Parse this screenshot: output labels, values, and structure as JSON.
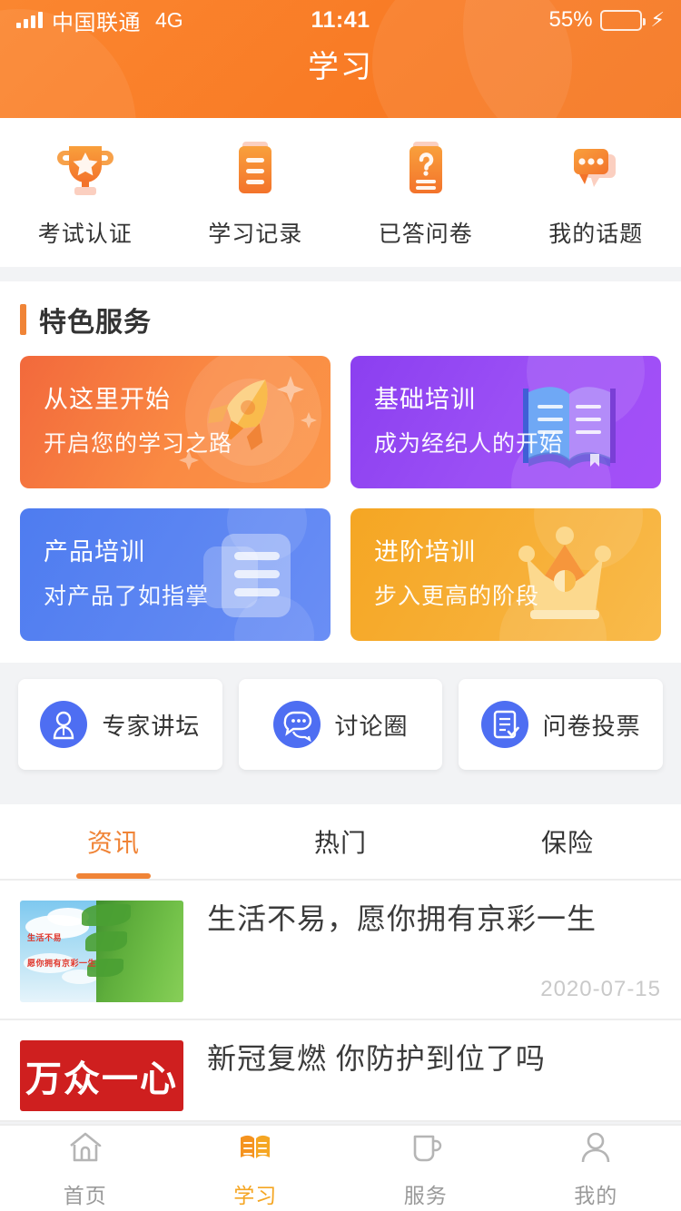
{
  "statusbar": {
    "carrier": "中国联通",
    "network": "4G",
    "time": "11:41",
    "battery_pct": "55%",
    "battery_level": 55,
    "charging_icon": "⚡"
  },
  "header": {
    "title": "学习",
    "bg_color": "#f97b25"
  },
  "quick_actions": [
    {
      "label": "考试认证",
      "icon": "trophy-icon"
    },
    {
      "label": "学习记录",
      "icon": "document-lines-icon"
    },
    {
      "label": "已答问卷",
      "icon": "document-question-icon"
    },
    {
      "label": "我的话题",
      "icon": "chat-bubble-icon"
    }
  ],
  "featured": {
    "section_title": "特色服务",
    "accent_color": "#f08437",
    "cards": [
      {
        "title": "从这里开始",
        "subtitle": "开启您的学习之路",
        "theme": "c-orange",
        "art": "rocket-icon",
        "color": "#f97b35"
      },
      {
        "title": "基础培训",
        "subtitle": "成为经纪人的开始",
        "theme": "c-purple",
        "art": "open-book-icon",
        "color": "#9b4ff5"
      },
      {
        "title": "产品培训",
        "subtitle": "对产品了如指掌",
        "theme": "c-blue",
        "art": "stacked-docs-icon",
        "color": "#5d86f2"
      },
      {
        "title": "进阶培训",
        "subtitle": "步入更高的阶段",
        "theme": "c-amber",
        "art": "crown-icon",
        "color": "#f7b038"
      }
    ]
  },
  "entries": [
    {
      "label": "专家讲坛",
      "icon": "person-icon"
    },
    {
      "label": "讨论圈",
      "icon": "chat-dots-icon"
    },
    {
      "label": "问卷投票",
      "icon": "form-check-icon"
    }
  ],
  "news_tabs": [
    {
      "label": "资讯",
      "active": true
    },
    {
      "label": "热门",
      "active": false
    },
    {
      "label": "保险",
      "active": false
    }
  ],
  "news": [
    {
      "title": "生活不易，愿你拥有京彩一生",
      "date": "2020-07-15",
      "thumb": "palm-sky-photo",
      "thumb_text_1": "生活不易",
      "thumb_text_2": "愿你拥有京彩一生"
    },
    {
      "title": "新冠复燃 你防护到位了吗",
      "date": "",
      "thumb": "wan-zhong-yi-xin-banner",
      "thumb_text_1": "万众一心",
      "thumb_text_2": ""
    }
  ],
  "tabbar": [
    {
      "label": "首页",
      "icon": "home-icon",
      "active": false
    },
    {
      "label": "学习",
      "icon": "book-icon",
      "active": true
    },
    {
      "label": "服务",
      "icon": "cup-icon",
      "active": false
    },
    {
      "label": "我的",
      "icon": "person-outline-icon",
      "active": false
    }
  ]
}
